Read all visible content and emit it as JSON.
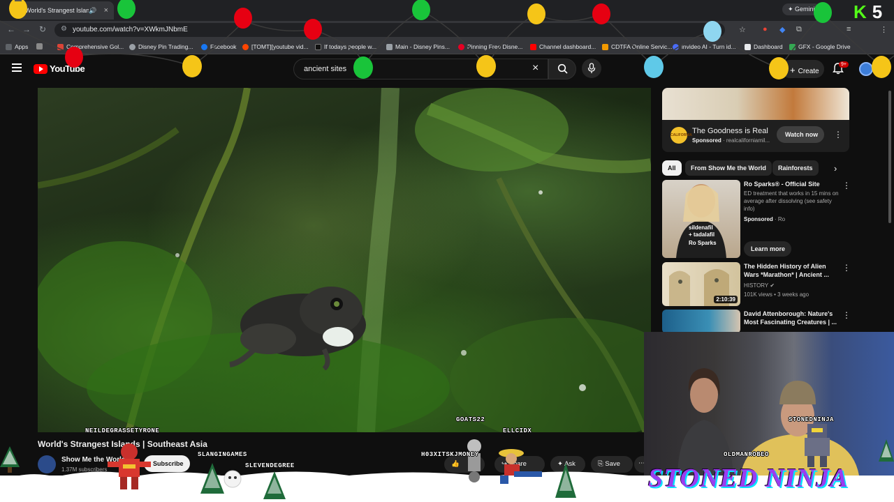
{
  "browser": {
    "tab_title": "World's Strangest Islan",
    "tab_close": "×",
    "gemini_label": "Gemini",
    "url": "youtube.com/watch?v=XWkmJNbmE",
    "overlay_logo": "K",
    "overlay_number": "5",
    "bookmarks": [
      {
        "label": "Apps",
        "color": "#5f6368"
      },
      {
        "label": "Comprehensive Gol...",
        "color": "#db4437"
      },
      {
        "label": "Disney Pin Trading...",
        "color": "#9aa0a6"
      },
      {
        "label": "Facebook",
        "color": "#1877f2"
      },
      {
        "label": "[TOMT][youtube vid...",
        "color": "#ff4500"
      },
      {
        "label": "If todays people w...",
        "color": "#111111"
      },
      {
        "label": "Main - Disney Pins...",
        "color": "#9aa0a6"
      },
      {
        "label": "Pinning Free Disne...",
        "color": "#e60023"
      },
      {
        "label": "Channel dashboard...",
        "color": "#ff0000"
      },
      {
        "label": "CDTFA Online Servic...",
        "color": "#f29900"
      },
      {
        "label": "invideo AI - Turn id...",
        "color": "#4a6cf7"
      },
      {
        "label": "Dashboard",
        "color": "#e8eaed"
      },
      {
        "label": "GFX - Google Drive",
        "color": "#34a853"
      }
    ]
  },
  "youtube": {
    "logo_text": "YouTube",
    "search_query": "ancient sites",
    "clear_icon": "×",
    "create_label": "Create",
    "notification_badge": "9+"
  },
  "video": {
    "title": "World's Strangest Islands | Southeast Asia",
    "channel": "Show Me the World",
    "subscribers": "1.37M subscribers",
    "subscribe_label": "Subscribe",
    "share_label": "Share",
    "ask_label": "Ask",
    "save_label": "Save",
    "more_icon": "⋯"
  },
  "sidebar": {
    "ad": {
      "logo_text": "CALIFORNIA",
      "title": "The Goodness is Real",
      "sponsored": "Sponsored",
      "domain": "realcaliforniamil...",
      "button": "Watch now"
    },
    "chips": [
      "All",
      "From Show Me the World",
      "Rainforests"
    ],
    "recommendations": [
      {
        "title": "Ro Sparks® - Official Site",
        "meta_line": "ED treatment that works in 15 mins on average after dissolving (see safety info)",
        "sponsored": "Sponsored",
        "advertiser": "Ro",
        "cta": "Learn more",
        "thumb_text_1": "sildenafil",
        "thumb_text_2": "+ tadalafil",
        "thumb_text_3": "Ro Sparks"
      },
      {
        "title": "The Hidden History of Alien Wars *Marathon* | Ancient ...",
        "channel": "HISTORY",
        "stats": "101K views • 3 weeks ago",
        "duration": "2:10:39"
      },
      {
        "title": "David Attenborough: Nature's Most Fascinating Creatures | ..."
      }
    ]
  },
  "stream": {
    "usernames": [
      "NEILDEGRASSETYRONE",
      "GOATS22",
      "ELLCIDX",
      "SLANGINGAMES",
      "SLEVENDEGREE",
      "H03XITSKJMONEY",
      "STONEDNINJA",
      "OLDMANROBEO"
    ],
    "brand": "STONED NINJA"
  }
}
